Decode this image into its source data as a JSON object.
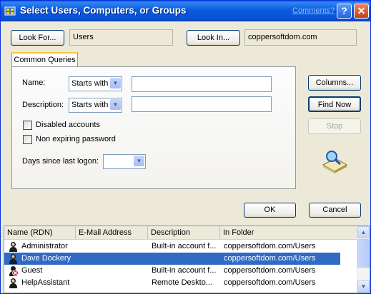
{
  "window": {
    "title": "Select Users, Computers, or Groups",
    "comments_link": "Comments?",
    "help_glyph": "?",
    "close_glyph": "✕"
  },
  "look_for": {
    "button_label": "Look For...",
    "value": "Users"
  },
  "look_in": {
    "button_label": "Look In...",
    "value": "coppersoftdom.com"
  },
  "tab": {
    "label": "Common Queries"
  },
  "query": {
    "name_label": "Name:",
    "name_mode": "Starts with",
    "name_value": "",
    "description_label": "Description:",
    "description_mode": "Starts with",
    "description_value": "",
    "disabled_accounts_label": "Disabled accounts",
    "disabled_accounts_checked": false,
    "non_expiring_label": "Non expiring password",
    "non_expiring_checked": false,
    "days_label": "Days since last logon:",
    "days_value": ""
  },
  "side_buttons": {
    "columns": "Columns...",
    "find_now": "Find Now",
    "stop": "Stop"
  },
  "dialog_buttons": {
    "ok": "OK",
    "cancel": "Cancel"
  },
  "results": {
    "columns": [
      "Name (RDN)",
      "E-Mail Address",
      "Description",
      "In Folder"
    ],
    "rows": [
      {
        "name": "Administrator",
        "email": "",
        "description": "Built-in account f...",
        "folder": "coppersoftdom.com/Users",
        "selected": false,
        "icon": "user-icon"
      },
      {
        "name": "Dave Dockery",
        "email": "",
        "description": "",
        "folder": "coppersoftdom.com/Users",
        "selected": true,
        "icon": "user-icon"
      },
      {
        "name": "Guest",
        "email": "",
        "description": "Built-in account f...",
        "folder": "coppersoftdom.com/Users",
        "selected": false,
        "icon": "disabled-user-icon"
      },
      {
        "name": "HelpAssistant",
        "email": "",
        "description": "Remote Deskto...",
        "folder": "coppersoftdom.com/Users",
        "selected": false,
        "icon": "user-icon"
      }
    ]
  },
  "colors": {
    "title_bar": "#0a5fd8",
    "selection": "#316ac5",
    "tab_accent": "#ffc83c"
  },
  "icons": [
    "app-icon",
    "help-icon",
    "close-icon",
    "chevron-down-icon",
    "search-directory-icon",
    "user-icon",
    "disabled-user-icon",
    "scroll-up-icon",
    "scroll-down-icon"
  ]
}
